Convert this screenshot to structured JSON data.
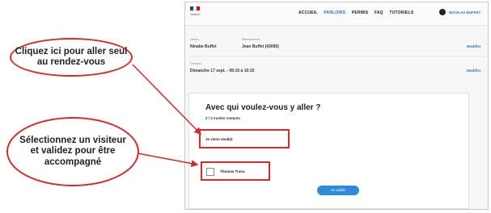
{
  "site": {
    "logo_text": "Justice",
    "flag_colors": [
      "#1f3fa6",
      "#ffffff",
      "#e1000f"
    ]
  },
  "nav": [
    "ACCUEIL",
    "PARLOIRS",
    "PERMIS",
    "FAQ",
    "TUTORIELS"
  ],
  "user_name": "NICOLAS BUFFET",
  "booking": {
    "detainee_label": "Détenu",
    "detainee_value": "Ninabe Buffet",
    "establishment_label": "Établissement",
    "establishment_value": "Jean Buffet (43095)",
    "slot_label": "Créneau",
    "slot_value": "Dimanche 17 sept. - 09:15 à 10:15",
    "modify_label": "Modifier"
  },
  "question": {
    "title": "Avec qui voulez-vous y aller ?",
    "subtitle": "2 / 2 invités restants",
    "option_alone": "Je viens seul(e)",
    "option_visitor": "Thomas Trano",
    "validate": "Je valide"
  },
  "callouts": {
    "alone": "Cliquez ici pour aller seul au rendez-vous",
    "visitor": "Sélectionnez un visiteur et validez pour être accompagné"
  },
  "colors": {
    "accent": "#2b6fd6",
    "callout_red": "#d22b2b",
    "button_blue": "#2f8bd9"
  }
}
